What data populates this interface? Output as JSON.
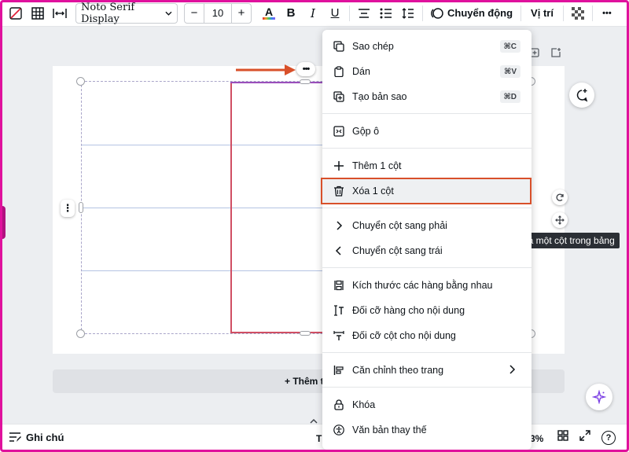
{
  "toolbar": {
    "font_family": "Noto Serif Display",
    "font_size": "10",
    "size_decrease": "−",
    "size_increase": "+",
    "text_color_glyph": "A",
    "bold": "B",
    "italic": "I",
    "underline": "U",
    "animate_label": "Chuyển động",
    "position_label": "Vị trí",
    "more": "•••"
  },
  "canvas": {
    "table_more": "•••",
    "side_more": "⋮",
    "add_page_label": "+ Thêm tra",
    "tooltip": "Xoá một cột trong bảng",
    "accent_color": "#d04f63",
    "selection_color": "#9a4fbb"
  },
  "context_menu": {
    "copy": {
      "label": "Sao chép",
      "shortcut": "⌘C"
    },
    "paste": {
      "label": "Dán",
      "shortcut": "⌘V"
    },
    "duplicate": {
      "label": "Tạo bản sao",
      "shortcut": "⌘D"
    },
    "merge": {
      "label": "Gộp ô"
    },
    "add_column": {
      "label": "Thêm 1 cột"
    },
    "delete_column": {
      "label": "Xóa 1 cột"
    },
    "move_right": {
      "label": "Chuyển cột sang phải"
    },
    "move_left": {
      "label": "Chuyển cột sang trái"
    },
    "equal_rows": {
      "label": "Kích thước các hàng bằng nhau"
    },
    "fit_rows": {
      "label": "Đối cỡ hàng cho nội dung"
    },
    "fit_columns": {
      "label": "Đối cỡ cột cho nội dung"
    },
    "align_page": {
      "label": "Căn chỉnh theo trang"
    },
    "lock": {
      "label": "Khóa"
    },
    "alt_text": {
      "label": "Văn bản thay thế"
    }
  },
  "bottom_bar": {
    "notes_label": "Ghi chú",
    "partial_t": "T",
    "zoom_partial": "3%",
    "help": "?"
  },
  "colors": {
    "frame": "#e0119d",
    "highlight_box": "#d8502a",
    "arrow": "#d8502a"
  }
}
